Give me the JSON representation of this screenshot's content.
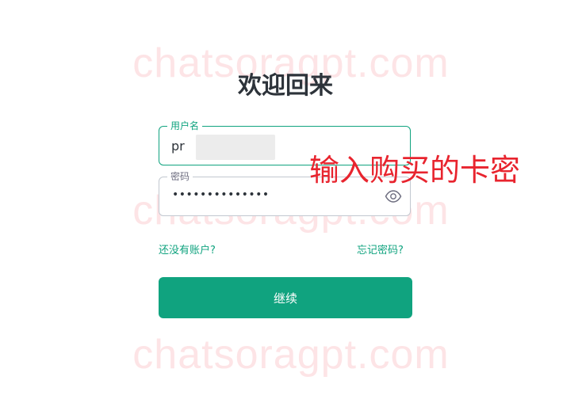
{
  "watermark": {
    "text": "chatsoragpt.com"
  },
  "page": {
    "title": "欢迎回来"
  },
  "username_field": {
    "label": "用户名",
    "value": "pr"
  },
  "password_field": {
    "label": "密码",
    "value": "••••••••••••••",
    "icon": "eye-icon"
  },
  "annotation": {
    "text": "输入购买的卡密",
    "color": "#e8242e"
  },
  "links": {
    "signup": "还没有账户?",
    "forgot": "忘记密码?"
  },
  "continue_button": {
    "label": "继续"
  },
  "colors": {
    "accent": "#10a37f",
    "title": "#2d333a",
    "watermark": "#fde4e6"
  }
}
